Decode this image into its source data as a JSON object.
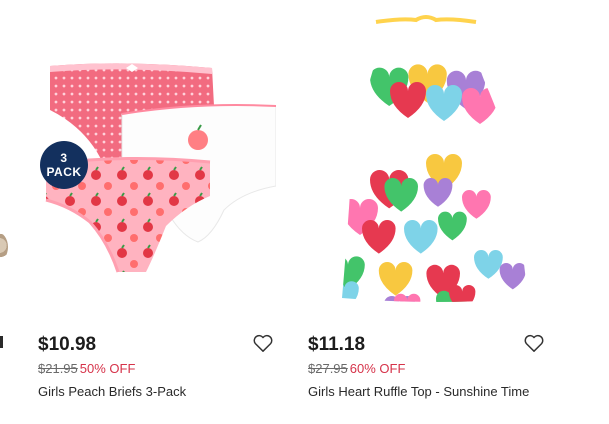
{
  "products": [
    {
      "price": "$10.98",
      "original_price": "$21.95",
      "discount": "50% OFF",
      "name": "Girls Peach Briefs 3-Pack",
      "badge_line1": "3",
      "badge_line2": "PACK",
      "image_icon": "peach-briefs-3-pack-image"
    },
    {
      "price": "$11.18",
      "original_price": "$27.95",
      "discount": "60% OFF",
      "name": "Girls Heart Ruffle Top - Sunshine Time",
      "image_icon": "heart-ruffle-top-image"
    }
  ],
  "colors": {
    "badge": "#13305e",
    "discount": "#d6334a",
    "strike_price": "#6a6a6a"
  }
}
